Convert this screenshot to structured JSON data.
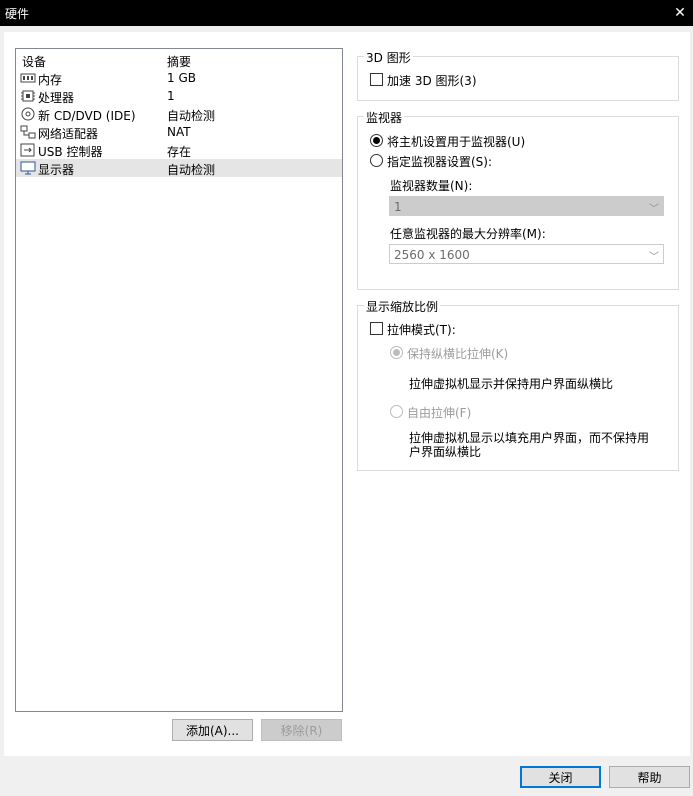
{
  "window": {
    "title": "硬件",
    "close_glyph": "✕"
  },
  "device_list": {
    "header": {
      "device": "设备",
      "summary": "摘要"
    },
    "items": [
      {
        "name": "内存",
        "summary": "1 GB",
        "icon": "memory-icon"
      },
      {
        "name": "处理器",
        "summary": "1",
        "icon": "processor-icon"
      },
      {
        "name": "新 CD/DVD (IDE)",
        "summary": "自动检测",
        "icon": "cd-dvd-icon"
      },
      {
        "name": "网络适配器",
        "summary": "NAT",
        "icon": "network-adapter-icon"
      },
      {
        "name": "USB 控制器",
        "summary": "存在",
        "icon": "usb-icon"
      },
      {
        "name": "显示器",
        "summary": "自动检测",
        "icon": "display-icon",
        "selected": true
      }
    ]
  },
  "buttons": {
    "add": "添加(A)...",
    "remove": "移除(R)",
    "close": "关闭",
    "help": "帮助"
  },
  "graphics_3d": {
    "legend": "3D 图形",
    "accelerate_label": "加速 3D 图形(3)",
    "accelerate_checked": false
  },
  "monitors": {
    "legend": "监视器",
    "use_host_label": "将主机设置用于监视器(U)",
    "specify_label": "指定监视器设置(S):",
    "selected_option": "use_host",
    "count_label": "监视器数量(N):",
    "count_value": "1",
    "max_res_label": "任意监视器的最大分辨率(M):",
    "max_res_value": "2560 x 1600"
  },
  "display_scaling": {
    "legend": "显示缩放比例",
    "stretch_label": "拉伸模式(T):",
    "stretch_checked": false,
    "keep_aspect_label": "保持纵横比拉伸(K)",
    "keep_aspect_desc": "拉伸虚拟机显示并保持用户界面纵横比",
    "free_label": "自由拉伸(F)",
    "free_desc_line1": "拉伸虚拟机显示以填充用户界面，而不保持用",
    "free_desc_line2": "户界面纵横比"
  },
  "colors": {
    "titlebar": "#000000",
    "selection": "#e5e5e5",
    "accent": "#0078d7",
    "disabled_text": "#9c9c9c"
  }
}
